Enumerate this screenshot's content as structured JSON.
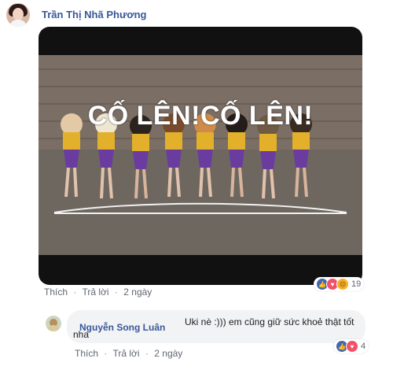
{
  "post": {
    "author": "Trần Thị Nhã Phương",
    "media_caption": "CỐ LÊN!CỐ LÊN!",
    "actions": {
      "like": "Thích",
      "reply": "Trả lời",
      "time": "2 ngày"
    },
    "reactions": {
      "types": [
        "like",
        "love",
        "sad"
      ],
      "count": "19"
    }
  },
  "reply": {
    "author": "Nguyễn Song Luân",
    "text": "Uki nè :))) em cũng giữ sức khoẻ thật tốt nha",
    "actions": {
      "like": "Thích",
      "reply": "Trả lời",
      "time": "2 ngày"
    },
    "reactions": {
      "types": [
        "like",
        "love"
      ],
      "count": "4"
    }
  }
}
